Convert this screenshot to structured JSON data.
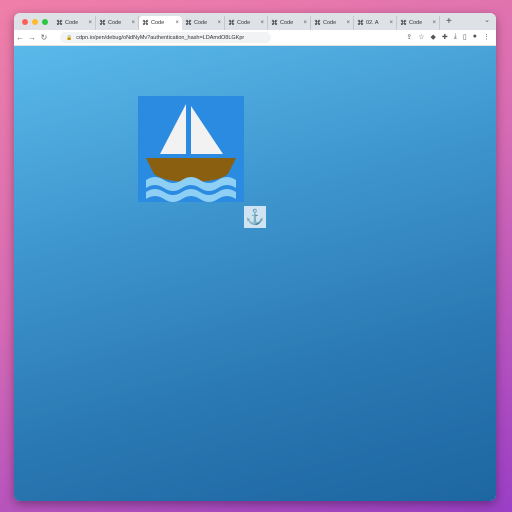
{
  "browser": {
    "tabs": [
      {
        "title": "Code",
        "active": false
      },
      {
        "title": "Code",
        "active": false
      },
      {
        "title": "Code",
        "active": true
      },
      {
        "title": "Code",
        "active": false
      },
      {
        "title": "Code",
        "active": false
      },
      {
        "title": "Code",
        "active": false
      },
      {
        "title": "Code",
        "active": false
      },
      {
        "title": "02. A",
        "active": false
      },
      {
        "title": "Code",
        "active": false
      }
    ],
    "new_tab": "+",
    "url": "cdpn.io/pen/debug/oNdNyMv?authentication_hash=LDAmdO8LGKpr"
  },
  "page": {
    "sailboat_icon": "sailboat-icon",
    "anchor_icon": "anchor-icon",
    "anchor_glyph": "⚓"
  },
  "colors": {
    "page_bg_top": "#5bb9ea",
    "page_bg_bottom": "#1d66a2",
    "tile_bg": "#2a8be0",
    "hull": "#8a5f10",
    "sail": "#f2f2f2",
    "waves": "#8ecff5"
  }
}
